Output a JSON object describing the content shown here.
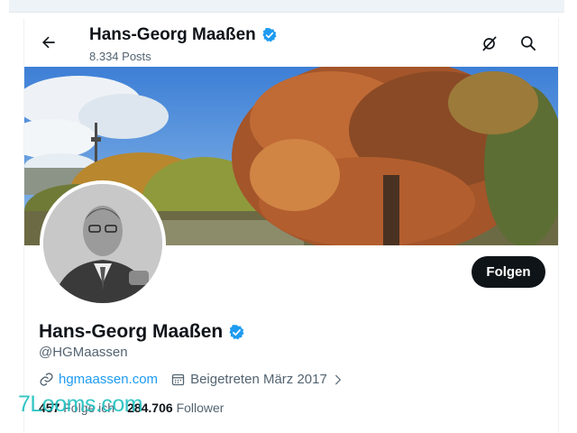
{
  "header": {
    "name": "Hans-Georg Maaßen",
    "posts": "8.334 Posts",
    "icons": {
      "back": "arrow-left-icon",
      "grok": "grok-icon",
      "search": "search-icon",
      "verified": "verified-badge-icon"
    }
  },
  "profile": {
    "name": "Hans-Georg Maaßen",
    "handle": "@HGMaassen",
    "follow_label": "Folgen",
    "website": "hgmaassen.com",
    "joined": "Beigetreten März 2017",
    "following_count": "457",
    "following_label": "Folge ich",
    "followers_count": "284.706",
    "followers_label": "Follower"
  },
  "watermark": "7Looms.com",
  "colors": {
    "accent": "#1d9bf0",
    "text": "#0f1419",
    "muted": "#536471",
    "button": "#0f1419"
  }
}
